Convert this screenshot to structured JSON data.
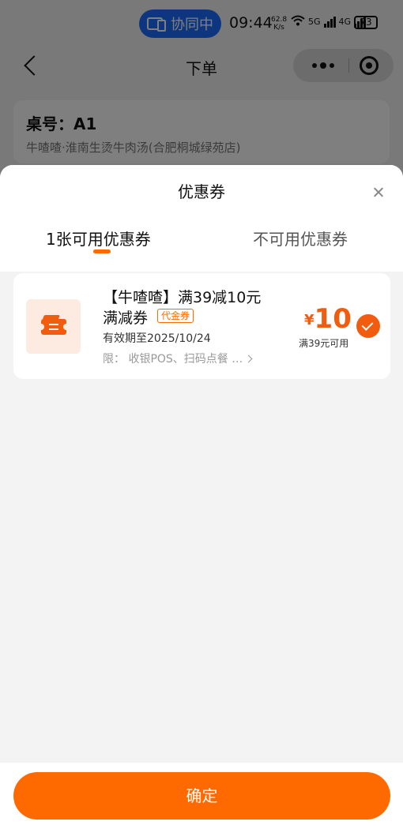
{
  "status_bar": {
    "collab_label": "协同中",
    "time": "09:44",
    "net_speed_value": "62.8",
    "net_speed_unit": "K/s",
    "net_type_1": "5G",
    "net_type_2": "4G",
    "battery": "73"
  },
  "nav": {
    "title": "下单"
  },
  "table_info": {
    "table_no": "桌号：A1",
    "store": "牛喳喳·淮南生烫牛肉汤(合肥桐城绿苑店)"
  },
  "coupon_sheet": {
    "title": "优惠券",
    "tabs": [
      {
        "label": "1张可用优惠券",
        "active": true
      },
      {
        "label": "不可用优惠券",
        "active": false
      }
    ],
    "coupons": [
      {
        "name_line1": "【牛喳喳】满39减10元",
        "name_line2": "满减券",
        "tag": "代金券",
        "validity": "有效期至2025/10/24",
        "limit": "限：  收银POS、扫码点餐 …",
        "currency": "¥",
        "amount": "10",
        "threshold": "满39元可用",
        "selected": true
      }
    ],
    "confirm_label": "确定"
  },
  "colors": {
    "accent": "#ff6a00",
    "collab_blue": "#1a6cff"
  }
}
